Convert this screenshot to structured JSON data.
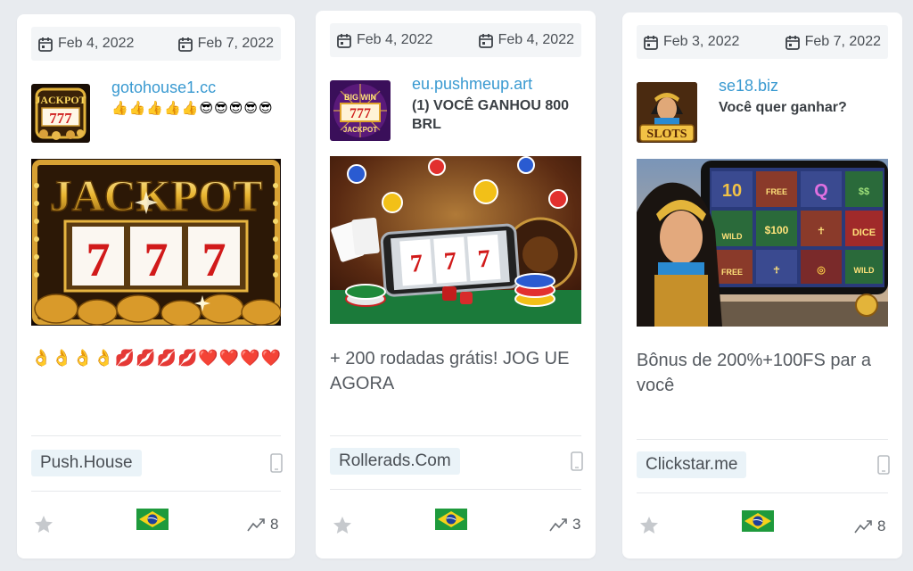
{
  "cards": [
    {
      "first_seen": "Feb 4, 2022",
      "last_seen": "Feb 7, 2022",
      "domain": "gotohouse1.cc",
      "headline_emojis": [
        "👍",
        "👍",
        "👍",
        "👍",
        "👍",
        "😎",
        "😎",
        "😎",
        "😎",
        "😎"
      ],
      "thumb_icon": "jackpot-777-icon",
      "hero_image": "jackpot-777-slot",
      "body_emojis": [
        "👌",
        "👌",
        "👌",
        "👌",
        "💋",
        "💋",
        "💋",
        "💋",
        "❤️",
        "❤️",
        "❤️",
        "❤️"
      ],
      "network": "Push.House",
      "device_icon": "mobile-phone-icon",
      "country_flag": "brazil-flag-icon",
      "count": "8"
    },
    {
      "first_seen": "Feb 4, 2022",
      "last_seen": "Feb 4, 2022",
      "domain": "eu.pushmeup.art",
      "headline": "(1) VOCÊ GANHOU 800 BRL",
      "thumb_icon": "big-win-777-icon",
      "hero_image": "slot-machine-phone-casino",
      "body": "+ 200 rodadas grátis! JOG UE AGORA",
      "network": "Rollerads.Com",
      "device_icon": "mobile-phone-icon",
      "country_flag": "brazil-flag-icon",
      "count": "3"
    },
    {
      "first_seen": "Feb 3, 2022",
      "last_seen": "Feb 7, 2022",
      "domain": "se18.biz",
      "headline": "Você quer ganhar?",
      "thumb_icon": "cleopatra-slots-icon",
      "hero_image": "cleopatra-slot-game",
      "body": "Bônus de 200%+100FS par a você",
      "network": "Clickstar.me",
      "device_icon": "mobile-phone-icon",
      "country_flag": "brazil-flag-icon",
      "count": "8"
    }
  ],
  "colors": {
    "background": "#e8ebef",
    "domain_link": "#3a9ad1",
    "network_badge": "#eaf3f8",
    "star": "#c6c9cd"
  }
}
